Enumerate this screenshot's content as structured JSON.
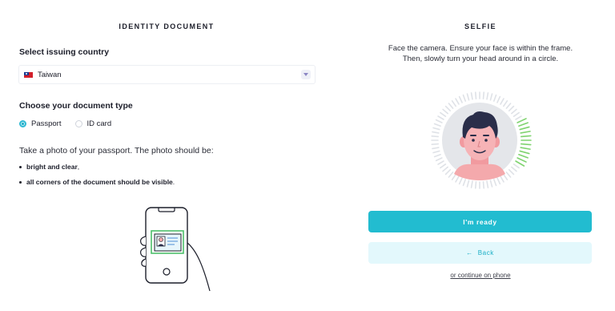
{
  "identity": {
    "heading": "IDENTITY DOCUMENT",
    "country_label": "Select issuing country",
    "country_value": "Taiwan",
    "doc_type_label": "Choose your document type",
    "doc_types": [
      {
        "label": "Passport",
        "selected": true
      },
      {
        "label": "ID card",
        "selected": false
      }
    ],
    "instruction": "Take a photo of your passport. The photo should be:",
    "requirements": [
      {
        "bold": "bright and clear",
        "suffix": ","
      },
      {
        "bold": "all corners of the document should be visible",
        "suffix": "."
      }
    ]
  },
  "selfie": {
    "heading": "SELFIE",
    "instructions_line1": "Face the camera. Ensure your face is within the frame.",
    "instructions_line2": "Then, slowly turn your head around in a circle.",
    "ready_label": "I'm ready",
    "back_label": "Back",
    "phone_link": "or continue on phone"
  },
  "colors": {
    "accent": "#22bcd0",
    "accent_light": "#e3f8fc",
    "progress_green": "#7fd36f",
    "face_skin": "#f4a9ac",
    "hair": "#2a2e4a"
  },
  "icons": {
    "flag": "taiwan-flag-icon",
    "dropdown": "chevron-down-icon",
    "back": "arrow-left-icon"
  }
}
